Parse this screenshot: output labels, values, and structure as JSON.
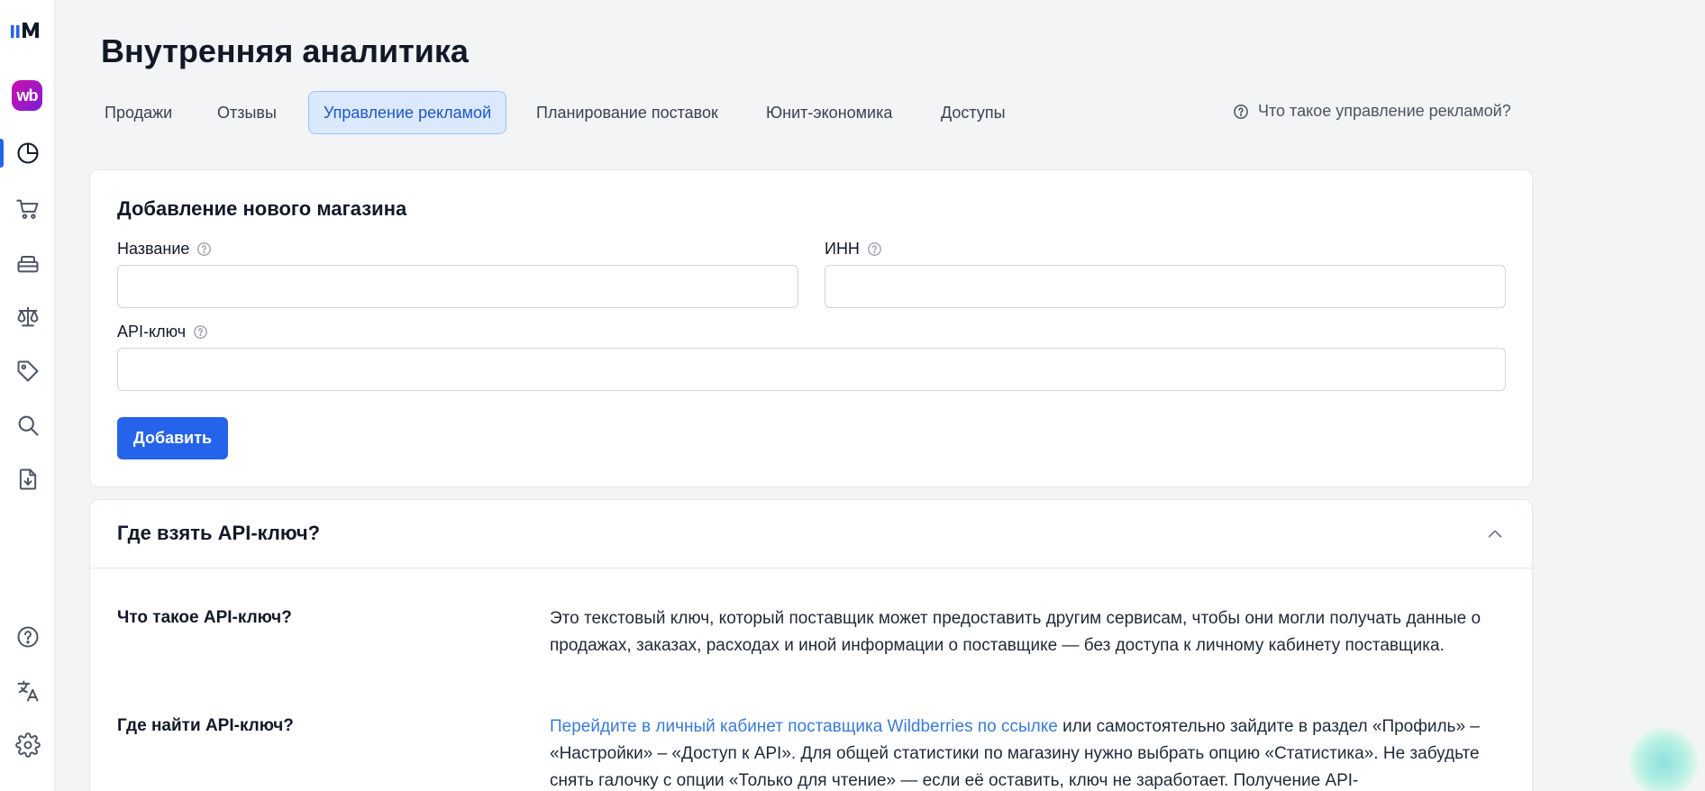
{
  "page": {
    "title": "Внутренняя аналитика"
  },
  "brand": {
    "wb_badge": "wb",
    "accent": "#2563eb"
  },
  "sidebar": {
    "items": [
      {
        "name": "logo",
        "icon": "logo-mark"
      },
      {
        "name": "wb-store",
        "icon": "wb-badge"
      },
      {
        "name": "analytics",
        "icon": "pie-chart-icon",
        "active": true
      },
      {
        "name": "cart",
        "icon": "cart-icon"
      },
      {
        "name": "warehouse",
        "icon": "box-stack-icon"
      },
      {
        "name": "scales",
        "icon": "scales-icon"
      },
      {
        "name": "tags",
        "icon": "tag-icon"
      },
      {
        "name": "search",
        "icon": "search-icon"
      },
      {
        "name": "download",
        "icon": "file-download-icon"
      },
      {
        "name": "help",
        "icon": "question-circle-icon"
      },
      {
        "name": "language",
        "icon": "translate-icon"
      },
      {
        "name": "settings",
        "icon": "gear-icon"
      }
    ]
  },
  "tabs": [
    {
      "label": "Продажи"
    },
    {
      "label": "Отзывы"
    },
    {
      "label": "Управление рекламой",
      "active": true
    },
    {
      "label": "Планирование поставок"
    },
    {
      "label": "Юнит-экономика"
    },
    {
      "label": "Доступы"
    }
  ],
  "help_link": {
    "label": "Что такое управление рекламой?"
  },
  "add_store": {
    "title": "Добавление нового магазина",
    "name_label": "Название",
    "name_value": "",
    "inn_label": "ИНН",
    "inn_value": "",
    "api_label": "API-ключ",
    "api_value": "",
    "submit_label": "Добавить"
  },
  "faq": {
    "title": "Где взять API-ключ?",
    "expanded": true,
    "items": [
      {
        "question": "Что такое API-ключ?",
        "answer": "Это текстовый ключ, который поставщик может предоставить другим сервисам, чтобы они могли получать данные о продажах, заказах, расходах и иной информации о поставщике — без доступа к личному кабинету поставщика."
      },
      {
        "question": "Где найти API-ключ?",
        "answer_link": "Перейдите в личный кабинет поставщика Wildberries по ссылке",
        "answer_rest": " или самостоятельно зайдите в раздел «Профиль» – «Настройки» – «Доступ к API». Для общей статистики по магазину нужно выбрать опцию «Статистика». Не забудьте снять галочку с опции «Только для чтение» — если её оставить, ключ не заработает. Получение API-"
      }
    ]
  }
}
